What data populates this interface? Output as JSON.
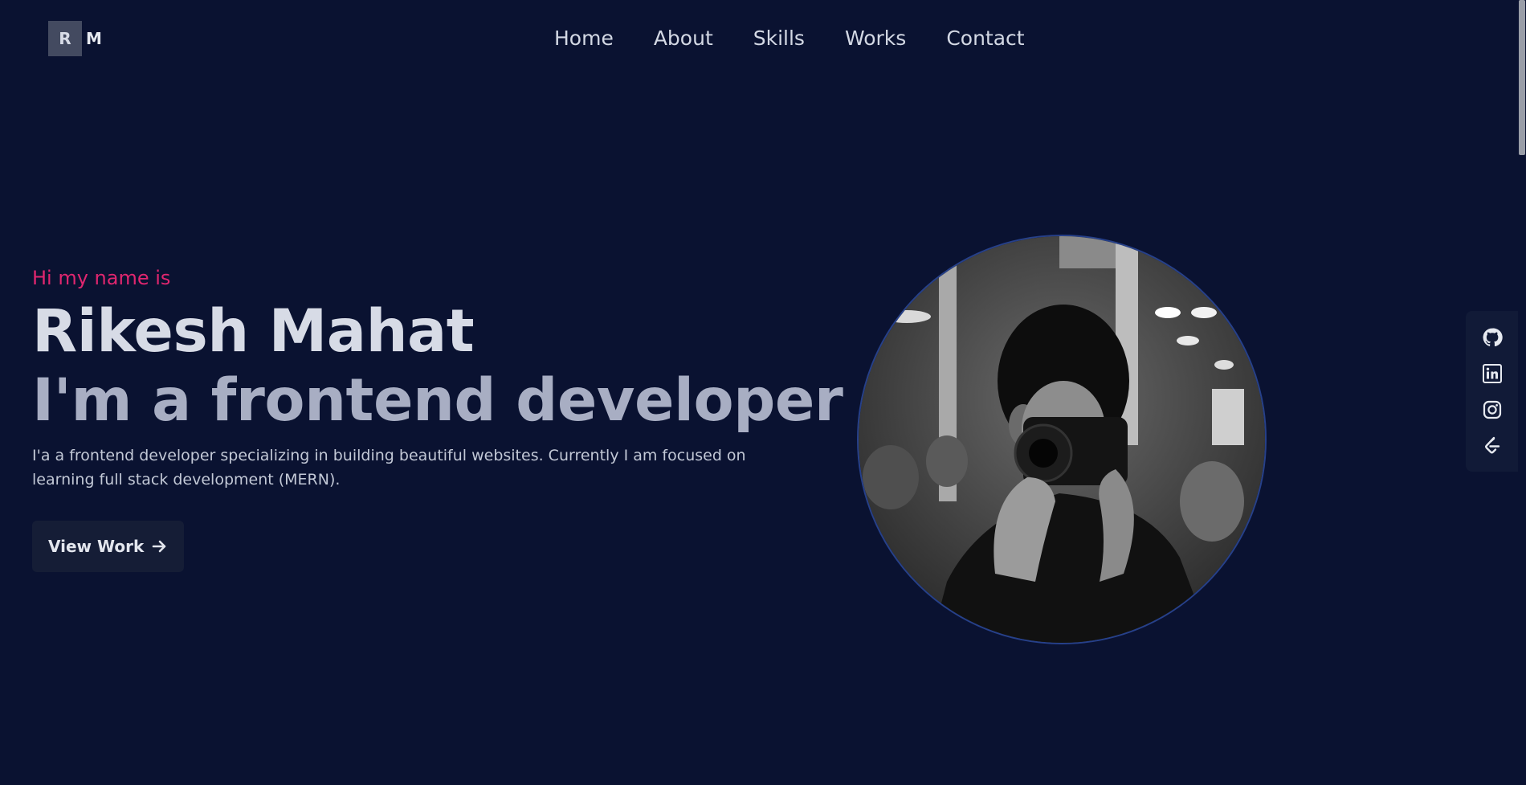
{
  "logo": {
    "first": "R",
    "second": "M"
  },
  "nav": {
    "items": [
      "Home",
      "About",
      "Skills",
      "Works",
      "Contact"
    ]
  },
  "hero": {
    "greeting": "Hi my name is",
    "name": "Rikesh Mahat",
    "role": "I'm a frontend developer",
    "description": "I'a a frontend developer specializing in building beautiful websites. Currently I am focused on learning full stack development (MERN).",
    "cta_label": "View Work"
  },
  "social": {
    "icons": [
      "github-icon",
      "linkedin-icon",
      "instagram-icon",
      "leetcode-icon"
    ]
  },
  "colors": {
    "background": "#0a1231",
    "accent": "#e0266f",
    "photo_border": "#26408a"
  }
}
